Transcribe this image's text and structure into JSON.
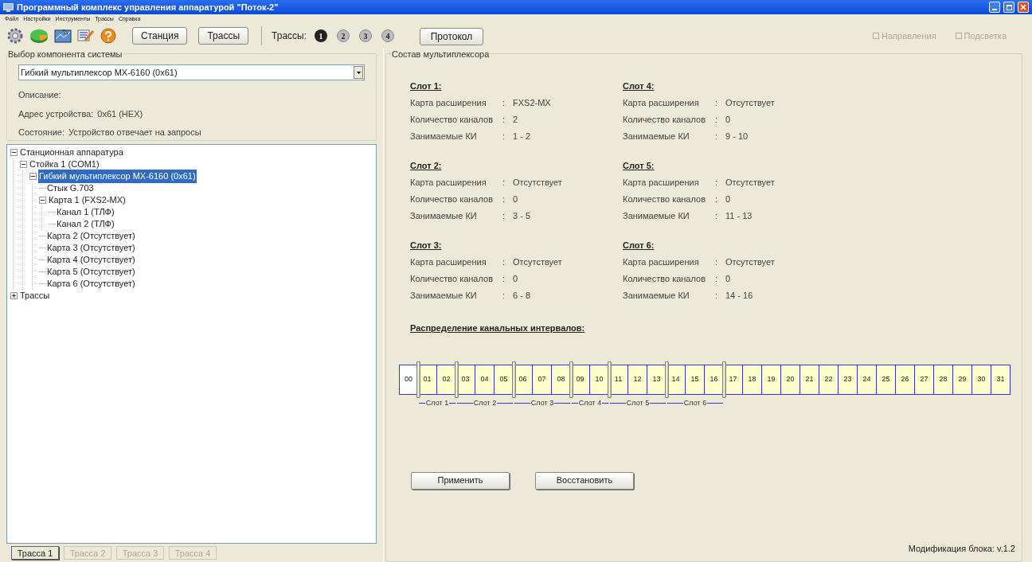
{
  "window": {
    "title": "Программный комплекс управления аппаратурой \"Поток-2\""
  },
  "menu": [
    "Файл",
    "Настройки",
    "Инструменты",
    "Трассы",
    "Справка"
  ],
  "toolbar": {
    "buttons": [
      "Станция",
      "Трассы"
    ],
    "traces_label": "Трассы:",
    "traces": [
      {
        "label": "1",
        "selected": true
      },
      {
        "label": "2",
        "selected": false
      },
      {
        "label": "3",
        "selected": false
      },
      {
        "label": "4",
        "selected": false
      }
    ],
    "protocol_button": "Протокол",
    "options": [
      {
        "label": "Направления",
        "checked": false,
        "disabled": true
      },
      {
        "label": "Подсветка",
        "checked": false,
        "disabled": true
      }
    ]
  },
  "component_group": {
    "title": "Выбор компонента системы",
    "selector": "Гибкий мультиплексор МХ-6160 (0x61)",
    "description_label": "Описание:",
    "fields": [
      {
        "label": "Адрес устройства:",
        "value": "0x61 (HEX)"
      },
      {
        "label": "Состояние:",
        "value": "Устройство отвечает на запросы"
      }
    ]
  },
  "tree": [
    {
      "label": "Станционная аппаратура",
      "expanded": true,
      "selected": false,
      "children": [
        {
          "label": "Стойка 1 (COM1)",
          "expanded": true,
          "selected": false,
          "children": [
            {
              "label": "Гибкий мультиплексор МХ-6160 (0x61)",
              "expanded": true,
              "selected": true,
              "children": [
                {
                  "label": "Стык G.703",
                  "selected": false
                },
                {
                  "label": "Карта 1 (FXS2-MX)",
                  "expanded": true,
                  "selected": false,
                  "children": [
                    {
                      "label": "Канал 1 (ТЛФ)",
                      "selected": false
                    },
                    {
                      "label": "Канал 2 (ТЛФ)",
                      "selected": false
                    }
                  ]
                },
                {
                  "label": "Карта 2 (Отсутствует)",
                  "selected": false
                },
                {
                  "label": "Карта 3 (Отсутствует)",
                  "selected": false
                },
                {
                  "label": "Карта 4 (Отсутствует)",
                  "selected": false
                },
                {
                  "label": "Карта 5 (Отсутствует)",
                  "selected": false
                },
                {
                  "label": "Карта 6 (Отсутствует)",
                  "selected": false
                }
              ]
            }
          ]
        }
      ]
    },
    {
      "label": "Трассы",
      "expanded": false,
      "selected": false
    }
  ],
  "trace_tabs": [
    {
      "label": "Трасса 1",
      "disabled": false
    },
    {
      "label": "Трасса 2",
      "disabled": true
    },
    {
      "label": "Трасса 3",
      "disabled": true
    },
    {
      "label": "Трасса 4",
      "disabled": true
    }
  ],
  "mux": {
    "title": "Состав мультиплексора",
    "slots": [
      {
        "title": "Слот 1:",
        "rows": [
          {
            "label": "Карта расширения",
            "value": "FXS2-MX"
          },
          {
            "label": "Количество каналов",
            "value": "2"
          },
          {
            "label": "Занимаемые КИ",
            "value": "1 - 2"
          }
        ]
      },
      {
        "title": "Слот 4:",
        "rows": [
          {
            "label": "Карта расширения",
            "value": "Отсутствует"
          },
          {
            "label": "Количество каналов",
            "value": "0"
          },
          {
            "label": "Занимаемые КИ",
            "value": "9 - 10"
          }
        ]
      },
      {
        "title": "Слот 2:",
        "rows": [
          {
            "label": "Карта расширения",
            "value": "Отсутствует"
          },
          {
            "label": "Количество каналов",
            "value": "0"
          },
          {
            "label": "Занимаемые КИ",
            "value": "3 - 5"
          }
        ]
      },
      {
        "title": "Слот 5:",
        "rows": [
          {
            "label": "Карта расширения",
            "value": "Отсутствует"
          },
          {
            "label": "Количество каналов",
            "value": "0"
          },
          {
            "label": "Занимаемые КИ",
            "value": "11 - 13"
          }
        ]
      },
      {
        "title": "Слот 3:",
        "rows": [
          {
            "label": "Карта расширения",
            "value": "Отсутствует"
          },
          {
            "label": "Количество каналов",
            "value": "0"
          },
          {
            "label": "Занимаемые КИ",
            "value": "6 - 8"
          }
        ]
      },
      {
        "title": "Слот 6:",
        "rows": [
          {
            "label": "Карта расширения",
            "value": "Отсутствует"
          },
          {
            "label": "Количество каналов",
            "value": "0"
          },
          {
            "label": "Занимаемые КИ",
            "value": "14 - 16"
          }
        ]
      }
    ],
    "separator": ":",
    "distribution_title": "Распределение канальных интервалов:",
    "groups": [
      {
        "kind": "free",
        "cells": [
          "00"
        ]
      },
      {
        "kind": "slot",
        "label": "Слот 1",
        "cells": [
          "01",
          "02"
        ]
      },
      {
        "kind": "slot",
        "label": "Слот 2",
        "cells": [
          "03",
          "04",
          "05"
        ]
      },
      {
        "kind": "slot",
        "label": "Слот 3",
        "cells": [
          "06",
          "07",
          "08"
        ]
      },
      {
        "kind": "slot",
        "label": "Слот 4",
        "cells": [
          "09",
          "10"
        ]
      },
      {
        "kind": "slot",
        "label": "Слот 5",
        "cells": [
          "11",
          "12",
          "13"
        ]
      },
      {
        "kind": "slot",
        "label": "Слот 6",
        "cells": [
          "14",
          "15",
          "16"
        ]
      },
      {
        "kind": "spare",
        "cells": [
          "17",
          "18",
          "19",
          "20",
          "21",
          "22",
          "23",
          "24",
          "25",
          "26",
          "27",
          "28",
          "29",
          "30",
          "31"
        ]
      }
    ],
    "buttons": [
      "Применить",
      "Восстановить"
    ],
    "footer": "Модификация блока: v.1.2"
  }
}
